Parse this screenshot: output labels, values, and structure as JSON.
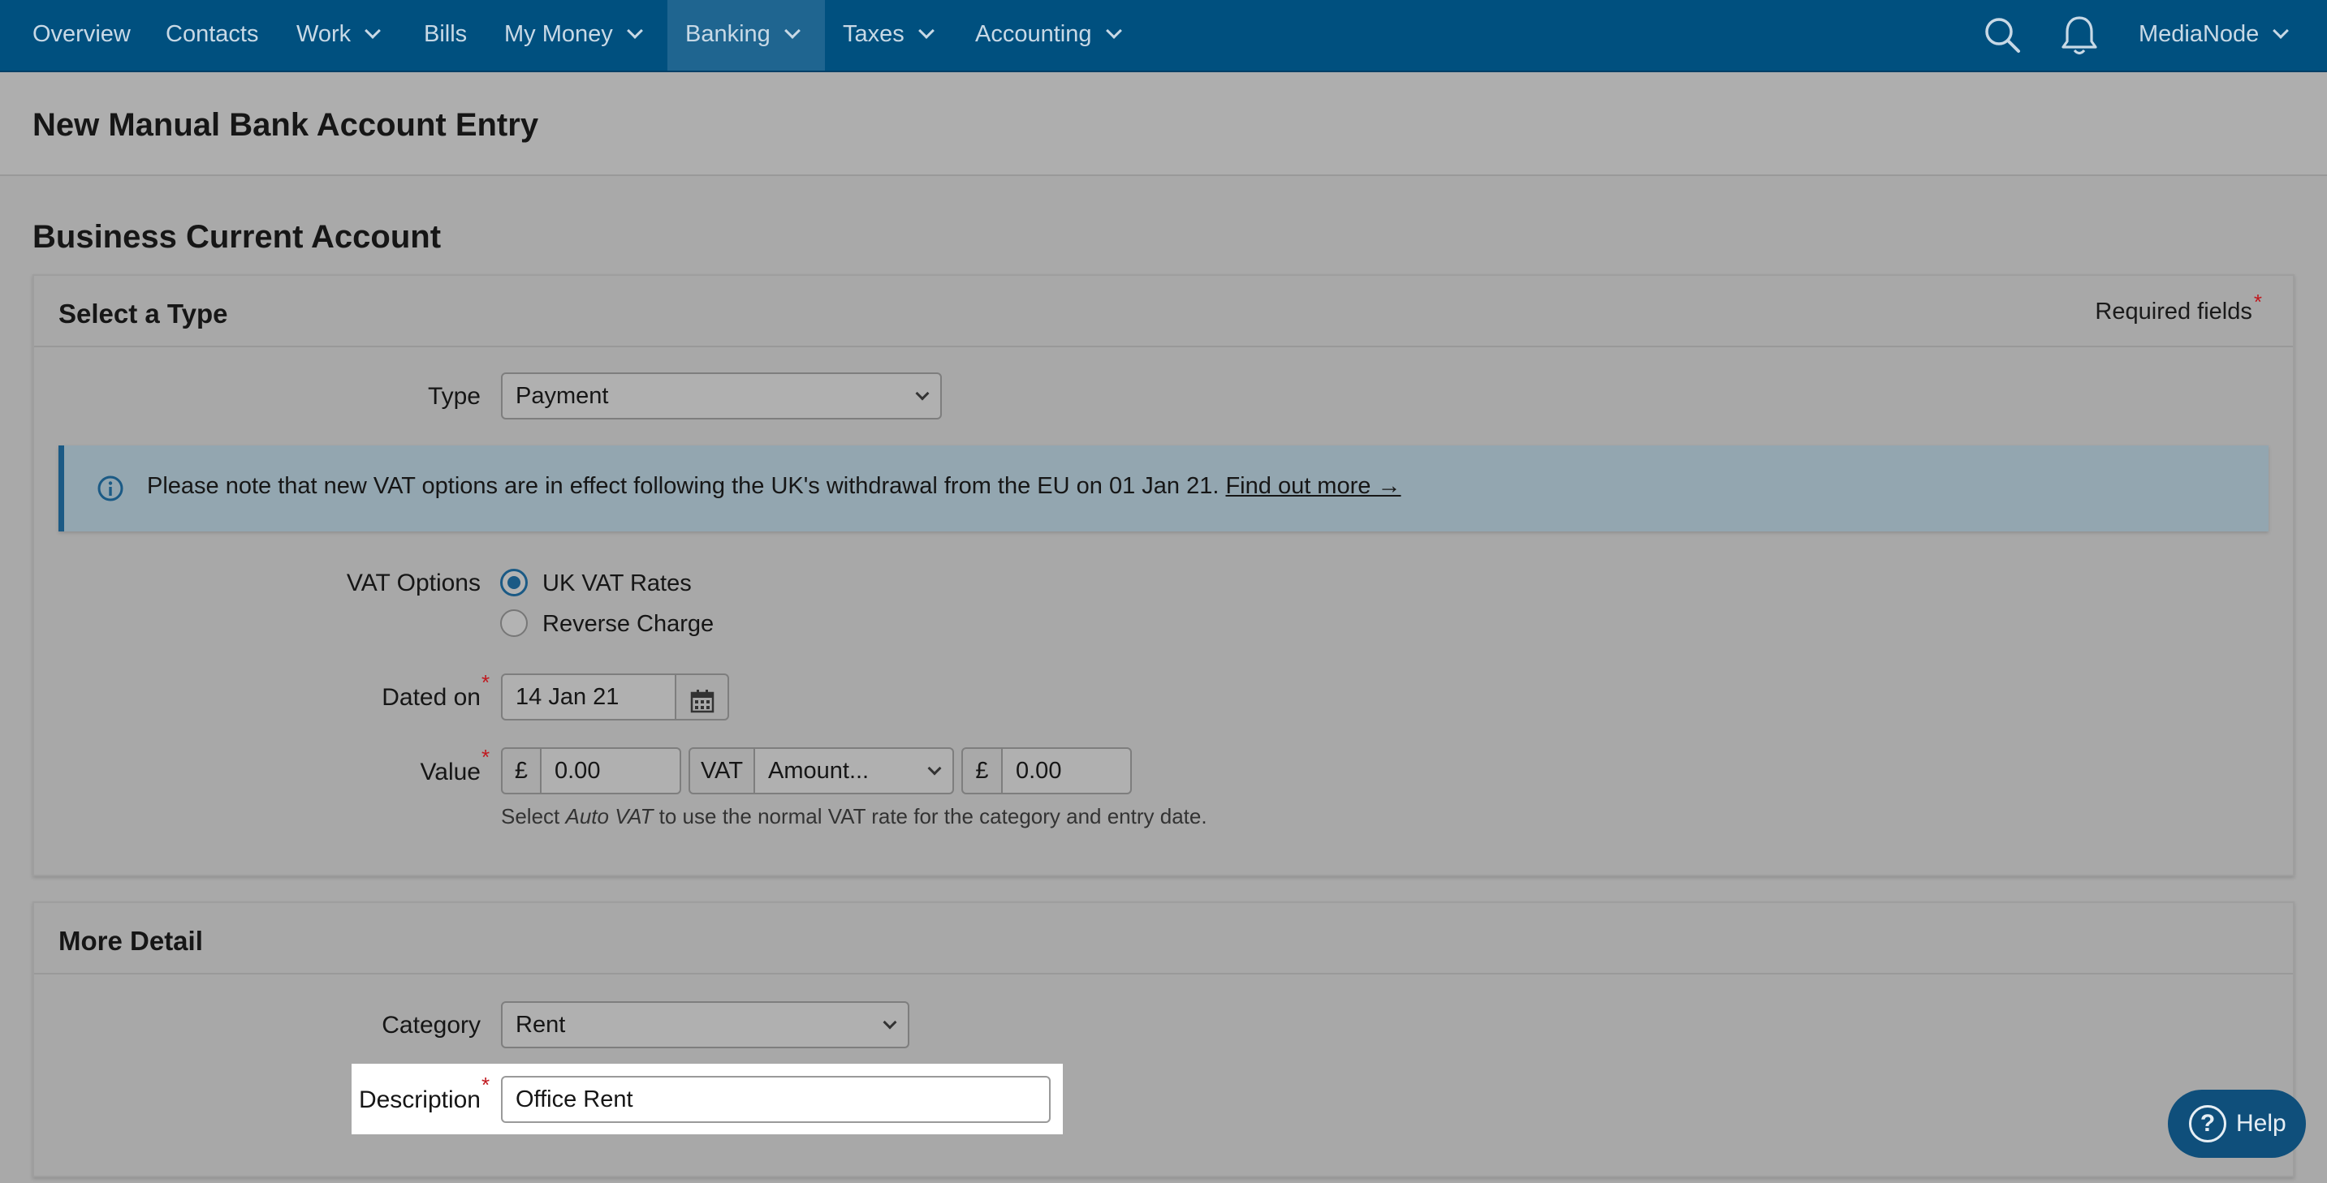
{
  "nav": {
    "items": [
      {
        "label": "Overview"
      },
      {
        "label": "Contacts"
      },
      {
        "label": "Work"
      },
      {
        "label": "Bills"
      },
      {
        "label": "My Money"
      },
      {
        "label": "Banking"
      },
      {
        "label": "Taxes"
      },
      {
        "label": "Accounting"
      }
    ],
    "active": "Banking",
    "account_label": "MediaNode",
    "icons": [
      "search-icon",
      "bell-icon"
    ]
  },
  "page": {
    "title": "New Manual Bank Account Entry",
    "account_title": "Business Current Account"
  },
  "select_type_panel": {
    "title": "Select a Type",
    "required_note": "Required fields",
    "required_mark": "*",
    "type_label": "Type",
    "type_value": "Payment",
    "info_text": "Please note that new VAT options are in effect following the UK's withdrawal from the EU on 01 Jan 21.",
    "info_link": "Find out more →",
    "vat_options_label": "VAT Options",
    "vat_options": [
      {
        "label": "UK VAT Rates",
        "selected": true
      },
      {
        "label": "Reverse Charge",
        "selected": false
      }
    ],
    "dated_on_label": "Dated on",
    "dated_on_value": "14 Jan 21",
    "value_label": "Value",
    "currency_symbol": "£",
    "value_amount": "0.00",
    "vat_addon": "VAT",
    "vat_mode": "Amount...",
    "vat_currency_symbol": "£",
    "vat_amount": "0.00",
    "hint_prefix": "Select ",
    "hint_emphasis": "Auto VAT",
    "hint_suffix": " to use the normal VAT rate for the category and entry date."
  },
  "more_detail_panel": {
    "title": "More Detail",
    "category_label": "Category",
    "category_value": "Rent",
    "description_label": "Description",
    "description_value": "Office Rent"
  },
  "help": {
    "label": "Help",
    "glyph": "?"
  },
  "colors": {
    "nav_bg": "#00507f",
    "accent": "#1b5a85",
    "required": "#c0181e",
    "info_bg": "#93a6b0"
  }
}
